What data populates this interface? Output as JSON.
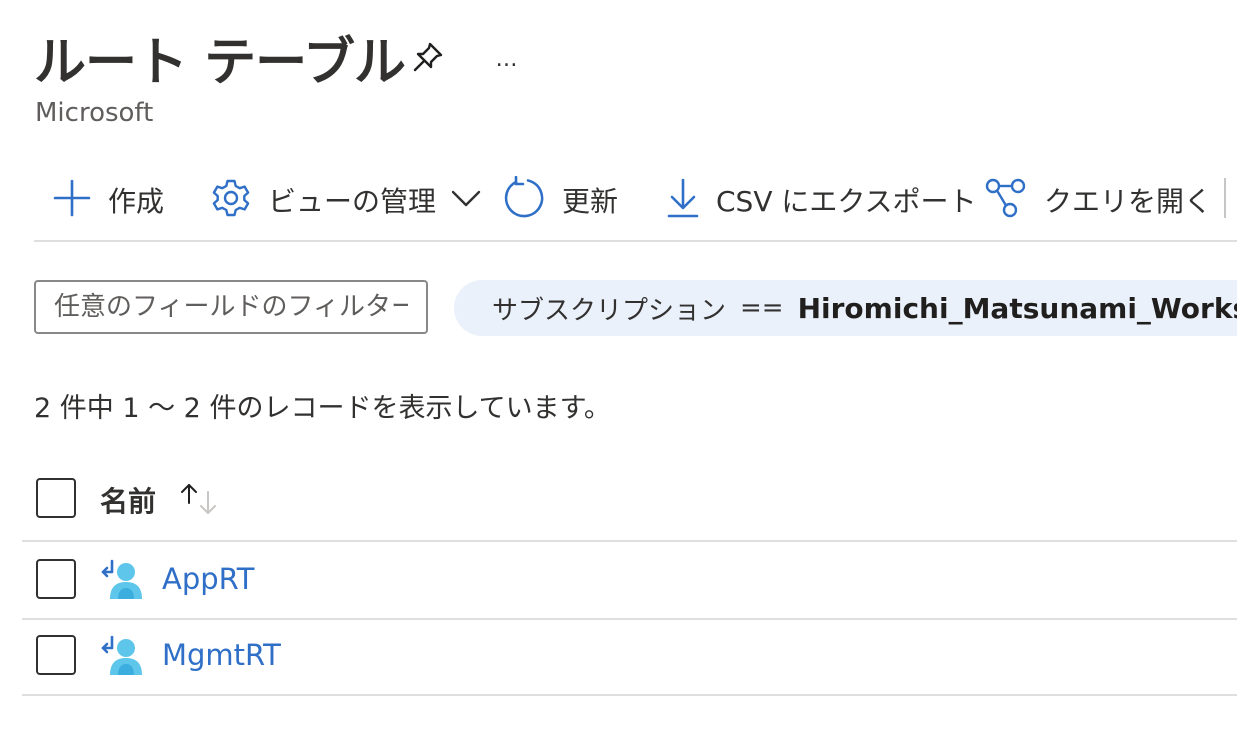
{
  "header": {
    "title": "ルート テーブル",
    "subtitle": "Microsoft",
    "more_label": "…"
  },
  "toolbar": {
    "create_label": "作成",
    "manage_view_label": "ビューの管理",
    "refresh_label": "更新",
    "export_csv_label": "CSV にエクスポート",
    "open_query_label": "クエリを開く"
  },
  "filter": {
    "placeholder": "任意のフィールドのフィルター...",
    "value": "",
    "pill_key": "サブスクリプション",
    "pill_operator": "==",
    "pill_value": "Hiromichi_Matsunami_Workspace"
  },
  "records": {
    "summary": "2 件中 1 ～ 2 件のレコードを表示しています。"
  },
  "table": {
    "columns": [
      {
        "label": "名前",
        "sort": "ascending"
      }
    ],
    "rows": [
      {
        "name": "AppRT"
      },
      {
        "name": "MgmtRT"
      }
    ]
  },
  "icons": {
    "create": "plus-icon",
    "manage_view": "gear-icon",
    "manage_view_chevron": "chevron-down-icon",
    "refresh": "refresh-icon",
    "export": "download-icon",
    "query": "query-graph-icon",
    "pin": "pin-icon",
    "row": "route-table-icon"
  },
  "colors": {
    "accent": "#2f6fc7",
    "pill_bg": "#eaf1fb",
    "text": "#323130"
  }
}
